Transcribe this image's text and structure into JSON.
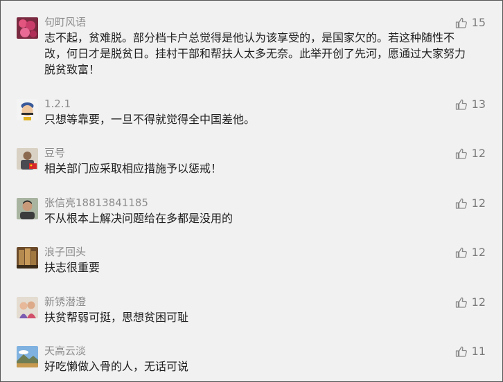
{
  "comments": [
    {
      "name": "句町风语",
      "likes": "15",
      "text": "志不起，贫难脱。部分档卡户总觉得是他认为该享受的，是国家欠的。若这种随性不改，何日才是脱贫日。挂村干部和帮扶人太多无奈。此举开创了先河，愿通过大家努力脱贫致富！",
      "avatar": "flower-avatar"
    },
    {
      "name": "1.2.1",
      "likes": "13",
      "text": "只想等靠要，一旦不得就觉得全中国差他。",
      "avatar": "cartoon-avatar"
    },
    {
      "name": "豆号",
      "likes": "12",
      "text": "相关部门应采取相应措施予以惩戒！",
      "avatar": "person-flag-avatar"
    },
    {
      "name": "张信亮18813841185",
      "likes": "12",
      "text": "不从根本上解决问题给在多都是没用的",
      "avatar": "person-avatar"
    },
    {
      "name": "浪子回头",
      "likes": "12",
      "text": "扶志很重要",
      "avatar": "building-avatar"
    },
    {
      "name": "新锈潜澄",
      "likes": "12",
      "text": "扶贫帮弱可挺，思想贫困可耻",
      "avatar": "couple-avatar"
    },
    {
      "name": "天高云淡",
      "likes": "11",
      "text": "好吃懒做入骨的人，无话可说",
      "avatar": "landscape-avatar"
    }
  ],
  "colors": {
    "background": "#f1f1f1",
    "name_text": "#8b8b8b",
    "content_text": "#202020",
    "like_text": "#7a7a7a"
  },
  "icons": {
    "like": "thumbs-up-icon"
  }
}
